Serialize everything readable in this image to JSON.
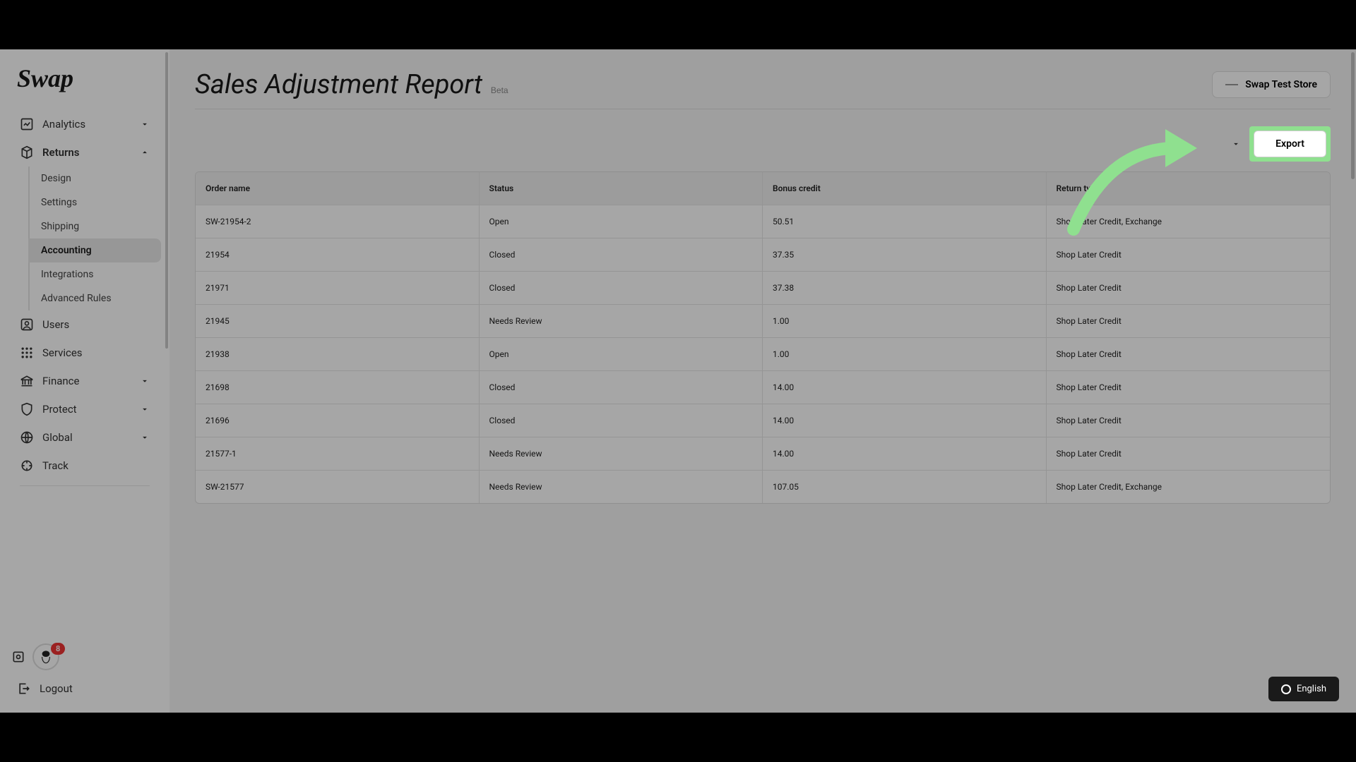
{
  "logo": "Swap",
  "sidebar": {
    "items": [
      {
        "label": "Analytics"
      },
      {
        "label": "Returns"
      }
    ],
    "sub_items": [
      {
        "label": "Design"
      },
      {
        "label": "Settings"
      },
      {
        "label": "Shipping"
      },
      {
        "label": "Accounting"
      },
      {
        "label": "Integrations"
      },
      {
        "label": "Advanced Rules"
      }
    ],
    "items_after": [
      {
        "label": "Users"
      },
      {
        "label": "Services"
      },
      {
        "label": "Finance"
      },
      {
        "label": "Protect"
      },
      {
        "label": "Global"
      },
      {
        "label": "Track"
      }
    ],
    "badge_count": "8",
    "logout": "Logout"
  },
  "header": {
    "title": "Sales Adjustment Report",
    "beta": "Beta",
    "store_name": "Swap Test Store"
  },
  "toolbar": {
    "export": "Export"
  },
  "table": {
    "columns": [
      "Order name",
      "Status",
      "Bonus credit",
      "Return type"
    ],
    "rows": [
      {
        "order": "SW-21954-2",
        "status": "Open",
        "credit": "50.51",
        "type": "Shop Later Credit, Exchange"
      },
      {
        "order": "21954",
        "status": "Closed",
        "credit": "37.35",
        "type": "Shop Later Credit"
      },
      {
        "order": "21971",
        "status": "Closed",
        "credit": "37.38",
        "type": "Shop Later Credit"
      },
      {
        "order": "21945",
        "status": "Needs Review",
        "credit": "1.00",
        "type": "Shop Later Credit"
      },
      {
        "order": "21938",
        "status": "Open",
        "credit": "1.00",
        "type": "Shop Later Credit"
      },
      {
        "order": "21698",
        "status": "Closed",
        "credit": "14.00",
        "type": "Shop Later Credit"
      },
      {
        "order": "21696",
        "status": "Closed",
        "credit": "14.00",
        "type": "Shop Later Credit"
      },
      {
        "order": "21577-1",
        "status": "Needs Review",
        "credit": "14.00",
        "type": "Shop Later Credit"
      },
      {
        "order": "SW-21577",
        "status": "Needs Review",
        "credit": "107.05",
        "type": "Shop Later Credit, Exchange"
      }
    ]
  },
  "lang": "English"
}
